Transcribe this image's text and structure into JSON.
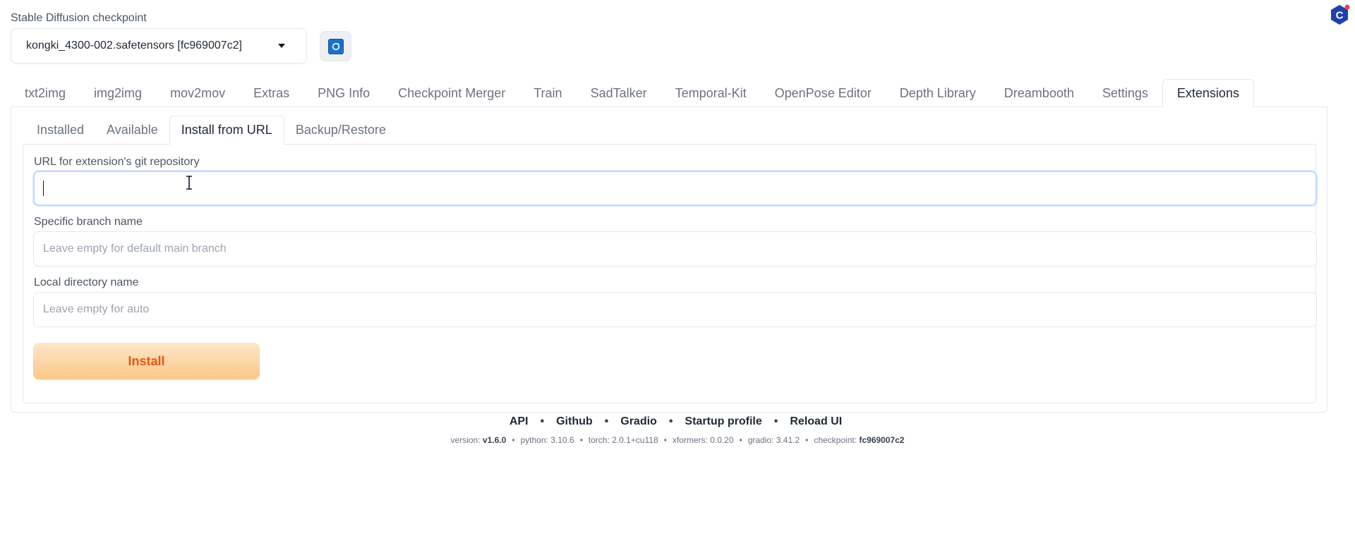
{
  "checkpoint": {
    "label": "Stable Diffusion checkpoint",
    "selected": "kongki_4300-002.safetensors [fc969007c2]"
  },
  "main_tabs": [
    {
      "label": "txt2img"
    },
    {
      "label": "img2img"
    },
    {
      "label": "mov2mov"
    },
    {
      "label": "Extras"
    },
    {
      "label": "PNG Info"
    },
    {
      "label": "Checkpoint Merger"
    },
    {
      "label": "Train"
    },
    {
      "label": "SadTalker"
    },
    {
      "label": "Temporal-Kit"
    },
    {
      "label": "OpenPose Editor"
    },
    {
      "label": "Depth Library"
    },
    {
      "label": "Dreambooth"
    },
    {
      "label": "Settings"
    },
    {
      "label": "Extensions",
      "active": true
    }
  ],
  "sub_tabs": [
    {
      "label": "Installed"
    },
    {
      "label": "Available"
    },
    {
      "label": "Install from URL",
      "active": true
    },
    {
      "label": "Backup/Restore"
    }
  ],
  "form": {
    "url_label": "URL for extension's git repository",
    "url_value": "",
    "branch_label": "Specific branch name",
    "branch_placeholder": "Leave empty for default main branch",
    "dir_label": "Local directory name",
    "dir_placeholder": "Leave empty for auto",
    "install_label": "Install"
  },
  "footer": {
    "links": [
      "API",
      "Github",
      "Gradio",
      "Startup profile",
      "Reload UI"
    ],
    "version_prefix": "version:",
    "version": "v1.6.0",
    "python": "python: 3.10.6",
    "torch": "torch: 2.0.1+cu118",
    "xformers": "xformers: 0.0.20",
    "gradio": "gradio: 3.41.2",
    "checkpoint_prefix": "checkpoint:",
    "checkpoint": "fc969007c2"
  },
  "colors": {
    "accent_orange": "#e8560f",
    "button_gradient_top": "#fde6c8",
    "button_gradient_bottom": "#fbc888",
    "refresh_blue": "#1d6fc9",
    "focus_border": "#bfdbfe"
  },
  "icons": {
    "refresh": "refresh-icon",
    "dropdown": "chevron-down-icon",
    "corner": "c-logo-icon",
    "cursor": "text-cursor-icon"
  }
}
